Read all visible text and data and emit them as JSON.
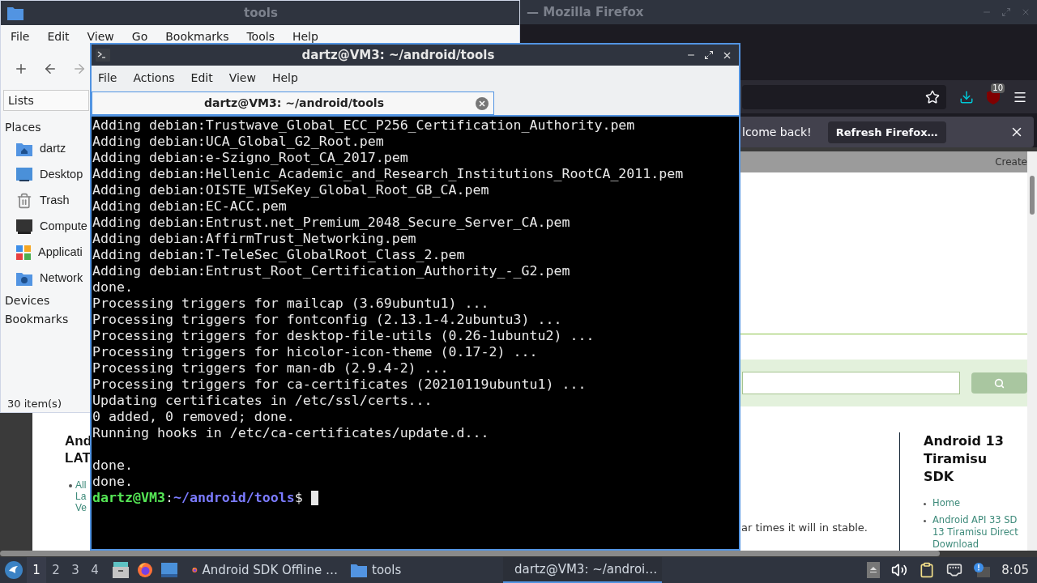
{
  "firefox": {
    "title": "— Mozilla Firefox",
    "badge": "10",
    "notification": {
      "text": "lcome back!",
      "button": "Refresh Firefox…"
    },
    "page": {
      "header_link": "Create",
      "left_heading": [
        "And",
        "LAT"
      ],
      "left_links": [
        "All",
        "La",
        "Ve"
      ],
      "body_text": "ar times it will in stable.",
      "sidebar": {
        "heading": "Android 13 Tiramisu SDK",
        "links": [
          {
            "lines": [
              "Home"
            ]
          },
          {
            "lines": [
              "Android API 33 SD",
              "13 Tiramisu Direct",
              "Download"
            ]
          }
        ]
      }
    }
  },
  "file_manager": {
    "title": "tools",
    "menu": [
      "File",
      "Edit",
      "View",
      "Go",
      "Bookmarks",
      "Tools",
      "Help"
    ],
    "sidebar_tab": "Lists",
    "places_heading": "Places",
    "places": [
      {
        "label": "dartz",
        "kind": "home"
      },
      {
        "label": "Desktop",
        "kind": "desktop"
      },
      {
        "label": "Trash",
        "kind": "trash"
      },
      {
        "label": "Compute",
        "kind": "computer"
      },
      {
        "label": "Applicati",
        "kind": "apps"
      },
      {
        "label": "Network",
        "kind": "network"
      }
    ],
    "sections": [
      "Devices",
      "Bookmarks"
    ],
    "status": "30 item(s)"
  },
  "terminal": {
    "title": "dartz@VM3: ~/android/tools",
    "menu": [
      "File",
      "Actions",
      "Edit",
      "View",
      "Help"
    ],
    "tab": {
      "label": "dartz@VM3: ~/android/tools",
      "selected": true
    },
    "lines": [
      "Adding debian:Trustwave_Global_ECC_P256_Certification_Authority.pem",
      "Adding debian:UCA_Global_G2_Root.pem",
      "Adding debian:e-Szigno_Root_CA_2017.pem",
      "Adding debian:Hellenic_Academic_and_Research_Institutions_RootCA_2011.pem",
      "Adding debian:OISTE_WISeKey_Global_Root_GB_CA.pem",
      "Adding debian:EC-ACC.pem",
      "Adding debian:Entrust.net_Premium_2048_Secure_Server_CA.pem",
      "Adding debian:AffirmTrust_Networking.pem",
      "Adding debian:T-TeleSec_GlobalRoot_Class_2.pem",
      "Adding debian:Entrust_Root_Certification_Authority_-_G2.pem",
      "done.",
      "Processing triggers for mailcap (3.69ubuntu1) ...",
      "Processing triggers for fontconfig (2.13.1-4.2ubuntu3) ...",
      "Processing triggers for desktop-file-utils (0.26-1ubuntu2) ...",
      "Processing triggers for hicolor-icon-theme (0.17-2) ...",
      "Processing triggers for man-db (2.9.4-2) ...",
      "Processing triggers for ca-certificates (20210119ubuntu1) ...",
      "Updating certificates in /etc/ssl/certs...",
      "0 added, 0 removed; done.",
      "Running hooks in /etc/ca-certificates/update.d..."
    ],
    "lines_after_blank": [
      "done.",
      "done."
    ],
    "prompt": {
      "user": "dartz@VM3",
      "separator": ":",
      "path": "~/android/tools",
      "symbol": "$"
    }
  },
  "taskbar": {
    "workspaces": [
      {
        "label": "1",
        "selected": true
      },
      {
        "label": "2",
        "selected": false
      },
      {
        "label": "3",
        "selected": false
      },
      {
        "label": "4",
        "selected": false
      }
    ],
    "tasks": [
      {
        "label": "Android SDK Offline …",
        "kind": "firefox",
        "selected": false
      },
      {
        "label": "tools",
        "kind": "folder",
        "selected": false
      },
      {
        "label": "dartz@VM3: ~/androi…",
        "kind": "terminal",
        "selected": true
      }
    ],
    "clock": "8:05"
  }
}
